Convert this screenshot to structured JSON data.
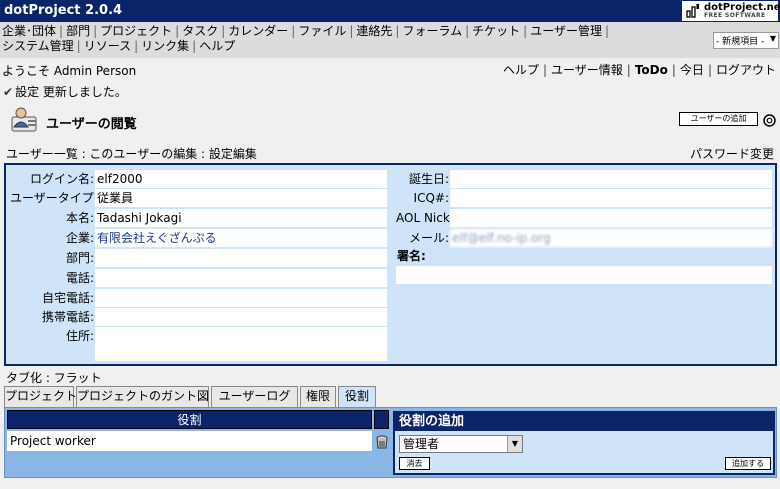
{
  "app": {
    "title": "dotProject 2.0.4",
    "logo_line1": "dotProject.net",
    "logo_line2": "FREE SOFTWARE"
  },
  "menu": {
    "items": [
      "企業･団体",
      "部門",
      "プロジェクト",
      "タスク",
      "カレンダー",
      "ファイル",
      "連絡先",
      "フォーラム",
      "チケット",
      "ユーザー管理",
      "システム管理",
      "リソース",
      "リンク集",
      "ヘルプ"
    ],
    "new_item": "- 新規項目 -"
  },
  "header": {
    "welcome": "ようこそ Admin Person",
    "links": [
      "ヘルプ",
      "ユーザー情報",
      "ToDo",
      "今日",
      "ログアウト"
    ]
  },
  "message": "設定 更新しました。",
  "page": {
    "title": "ユーザーの閲覧",
    "add_user_button": "ユーザーの追加",
    "breadcrumbs": "ユーザー一覧 : このユーザーの編集 : 設定編集",
    "change_password": "パスワード変更"
  },
  "user": {
    "left": [
      {
        "label": "ログイン名:",
        "value": "elf2000"
      },
      {
        "label": "ユーザータイプ:",
        "value": "従業員"
      },
      {
        "label": "本名:",
        "value": "Tadashi Jokagi"
      },
      {
        "label": "企業:",
        "value": "有限会社えぐざんぷる"
      },
      {
        "label": "部門:",
        "value": ""
      },
      {
        "label": "電話:",
        "value": ""
      },
      {
        "label": "自宅電話:",
        "value": ""
      },
      {
        "label": "携帯電話:",
        "value": ""
      },
      {
        "label": "住所:",
        "value": ""
      }
    ],
    "right": [
      {
        "label": "誕生日:",
        "value": ""
      },
      {
        "label": "ICQ#:",
        "value": ""
      },
      {
        "label": "AOL Nick:",
        "value": ""
      },
      {
        "label": "メール:",
        "value": "elf@elf.no-ip.org"
      }
    ],
    "signature_label": "署名:",
    "signature_value": ""
  },
  "tabs": {
    "mode": "タブ化 : フラット",
    "items": [
      "プロジェクト",
      "プロジェクトのガント図",
      "ユーザーログ",
      "権限",
      "役割"
    ],
    "active_index": 4
  },
  "roles": {
    "header": "役割",
    "rows": [
      "Project worker"
    ],
    "add_title": "役割の追加",
    "selected_role": "管理者",
    "clear_button": "消去",
    "add_button": "追加する"
  },
  "colors": {
    "title_bar": "#0a246a",
    "panel_bg": "#cfe4f8",
    "tab_panel_bg": "#8ab6e6"
  }
}
